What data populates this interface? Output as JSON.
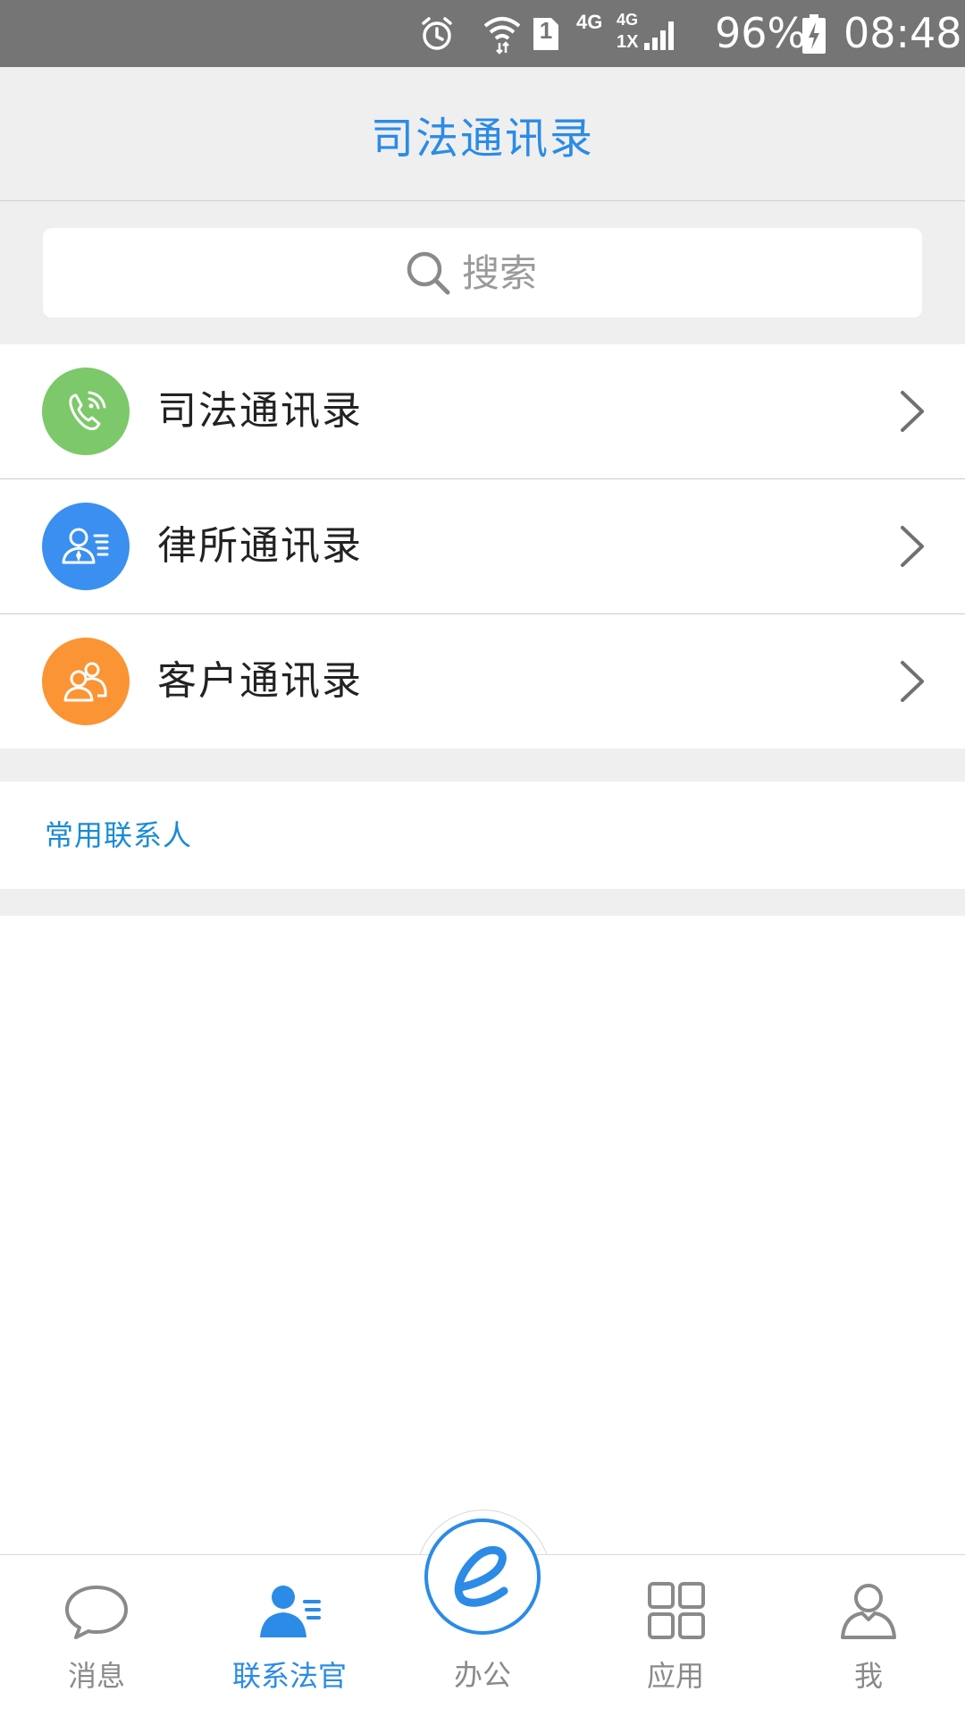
{
  "status_bar": {
    "network_4g": "4G",
    "network_4g_2": "4G",
    "network_1x": "1X",
    "sim_slot": "1",
    "battery": "96%",
    "time": "08:48"
  },
  "header": {
    "title": "司法通讯录"
  },
  "search": {
    "placeholder": "搜索"
  },
  "directories": [
    {
      "label": "司法通讯录",
      "icon": "judicial-phone-icon",
      "color": "#7cc86a"
    },
    {
      "label": "律所通讯录",
      "icon": "lawyer-contact-icon",
      "color": "#3a8ff0"
    },
    {
      "label": "客户通讯录",
      "icon": "clients-icon",
      "color": "#fb9434"
    }
  ],
  "frequent": {
    "title": "常用联系人"
  },
  "tabs": [
    {
      "label": "消息",
      "icon": "chat-bubble-icon",
      "active": false
    },
    {
      "label": "联系法官",
      "icon": "contact-judge-icon",
      "active": true
    },
    {
      "label": "办公",
      "icon": "office-e-icon",
      "active": false
    },
    {
      "label": "应用",
      "icon": "apps-grid-icon",
      "active": false
    },
    {
      "label": "我",
      "icon": "profile-icon",
      "active": false
    }
  ],
  "colors": {
    "accent": "#2b8be6",
    "section_title": "#1a8bd6",
    "status_bar": "#757575",
    "background_gray": "#efefef"
  }
}
